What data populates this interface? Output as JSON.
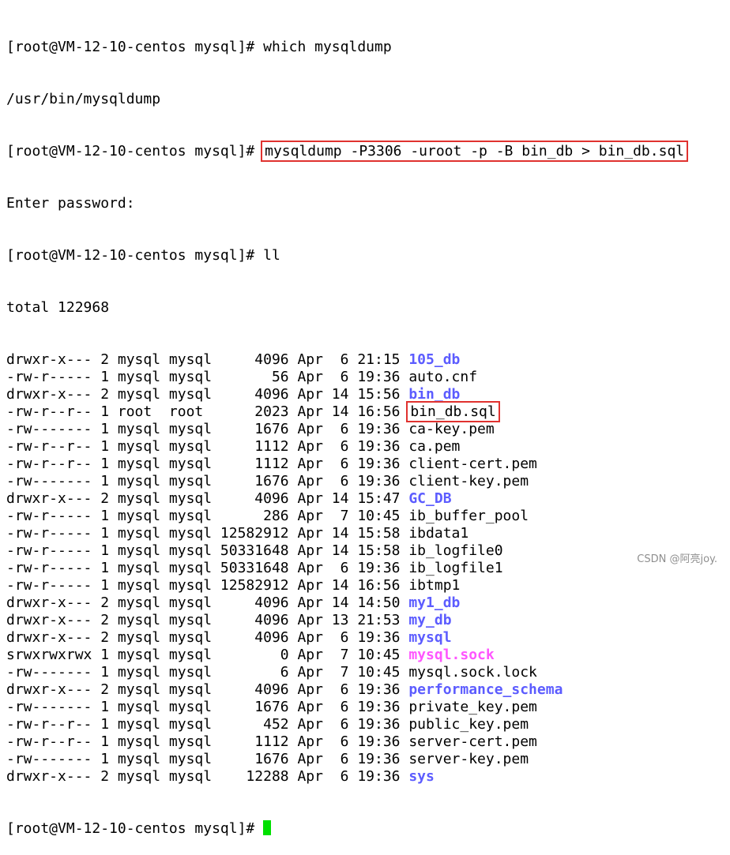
{
  "terminal": {
    "prompt": "[root@VM-12-10-centos mysql]# ",
    "which_cmd": "which mysqldump",
    "which_out": "/usr/bin/mysqldump",
    "dump_cmd": "mysqldump -P3306 -uroot -p -B bin_db > bin_db.sql",
    "enter_password": "Enter password:",
    "ll_cmd": "ll",
    "total": "total 122968",
    "listing": [
      {
        "meta": "drwxr-x--- 2 mysql mysql     4096 Apr  6 21:15 ",
        "name": "105_db",
        "kind": "dir"
      },
      {
        "meta": "-rw-r----- 1 mysql mysql       56 Apr  6 19:36 ",
        "name": "auto.cnf",
        "kind": "file"
      },
      {
        "meta": "drwxr-x--- 2 mysql mysql     4096 Apr 14 15:56 ",
        "name": "bin_db",
        "kind": "dir"
      },
      {
        "meta": "-rw-r--r-- 1 root  root      2023 Apr 14 16:56 ",
        "name": "bin_db.sql",
        "kind": "file",
        "highlight": true
      },
      {
        "meta": "-rw------- 1 mysql mysql     1676 Apr  6 19:36 ",
        "name": "ca-key.pem",
        "kind": "file"
      },
      {
        "meta": "-rw-r--r-- 1 mysql mysql     1112 Apr  6 19:36 ",
        "name": "ca.pem",
        "kind": "file"
      },
      {
        "meta": "-rw-r--r-- 1 mysql mysql     1112 Apr  6 19:36 ",
        "name": "client-cert.pem",
        "kind": "file"
      },
      {
        "meta": "-rw------- 1 mysql mysql     1676 Apr  6 19:36 ",
        "name": "client-key.pem",
        "kind": "file"
      },
      {
        "meta": "drwxr-x--- 2 mysql mysql     4096 Apr 14 15:47 ",
        "name": "GC_DB",
        "kind": "dir"
      },
      {
        "meta": "-rw-r----- 1 mysql mysql      286 Apr  7 10:45 ",
        "name": "ib_buffer_pool",
        "kind": "file"
      },
      {
        "meta": "-rw-r----- 1 mysql mysql 12582912 Apr 14 15:58 ",
        "name": "ibdata1",
        "kind": "file"
      },
      {
        "meta": "-rw-r----- 1 mysql mysql 50331648 Apr 14 15:58 ",
        "name": "ib_logfile0",
        "kind": "file"
      },
      {
        "meta": "-rw-r----- 1 mysql mysql 50331648 Apr  6 19:36 ",
        "name": "ib_logfile1",
        "kind": "file"
      },
      {
        "meta": "-rw-r----- 1 mysql mysql 12582912 Apr 14 16:56 ",
        "name": "ibtmp1",
        "kind": "file"
      },
      {
        "meta": "drwxr-x--- 2 mysql mysql     4096 Apr 14 14:50 ",
        "name": "my1_db",
        "kind": "dir"
      },
      {
        "meta": "drwxr-x--- 2 mysql mysql     4096 Apr 13 21:53 ",
        "name": "my_db",
        "kind": "dir"
      },
      {
        "meta": "drwxr-x--- 2 mysql mysql     4096 Apr  6 19:36 ",
        "name": "mysql",
        "kind": "dir"
      },
      {
        "meta": "srwxrwxrwx 1 mysql mysql        0 Apr  7 10:45 ",
        "name": "mysql.sock",
        "kind": "sock"
      },
      {
        "meta": "-rw------- 1 mysql mysql        6 Apr  7 10:45 ",
        "name": "mysql.sock.lock",
        "kind": "file"
      },
      {
        "meta": "drwxr-x--- 2 mysql mysql     4096 Apr  6 19:36 ",
        "name": "performance_schema",
        "kind": "dir"
      },
      {
        "meta": "-rw------- 1 mysql mysql     1676 Apr  6 19:36 ",
        "name": "private_key.pem",
        "kind": "file"
      },
      {
        "meta": "-rw-r--r-- 1 mysql mysql      452 Apr  6 19:36 ",
        "name": "public_key.pem",
        "kind": "file"
      },
      {
        "meta": "-rw-r--r-- 1 mysql mysql     1112 Apr  6 19:36 ",
        "name": "server-cert.pem",
        "kind": "file"
      },
      {
        "meta": "-rw------- 1 mysql mysql     1676 Apr  6 19:36 ",
        "name": "server-key.pem",
        "kind": "file"
      },
      {
        "meta": "drwxr-x--- 2 mysql mysql    12288 Apr  6 19:36 ",
        "name": "sys",
        "kind": "dir"
      }
    ]
  },
  "watermark": "CSDN @阿亮joy.",
  "colors": {
    "dir": "#5c5cff",
    "sock": "#ff55ff",
    "highlight_box": "#e0322f",
    "cursor": "#00e000"
  }
}
